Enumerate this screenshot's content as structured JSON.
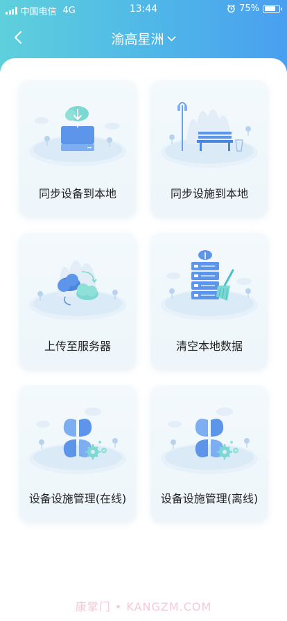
{
  "status_bar": {
    "carrier": "中国电信",
    "network": "4G",
    "time": "13:44",
    "battery": "75%",
    "battery_level": 0.75
  },
  "nav": {
    "title": "渝高星洲"
  },
  "menu": [
    {
      "label": "同步设备到本地",
      "icon": "server-download-icon"
    },
    {
      "label": "同步设施到本地",
      "icon": "park-bench-icon"
    },
    {
      "label": "上传至服务器",
      "icon": "cloud-sync-icon"
    },
    {
      "label": "清空本地数据",
      "icon": "database-clear-icon"
    },
    {
      "label": "设备设施管理(在线)",
      "icon": "management-gears-icon"
    },
    {
      "label": "设备设施管理(离线)",
      "icon": "management-gears-icon"
    }
  ],
  "watermark": "康掌门 • KANGZM.COM",
  "colors": {
    "header_start": "#5ed0dc",
    "header_end": "#4a9ff0",
    "accent": "#4aa3e6",
    "card_bg": "#f3f9fc"
  }
}
